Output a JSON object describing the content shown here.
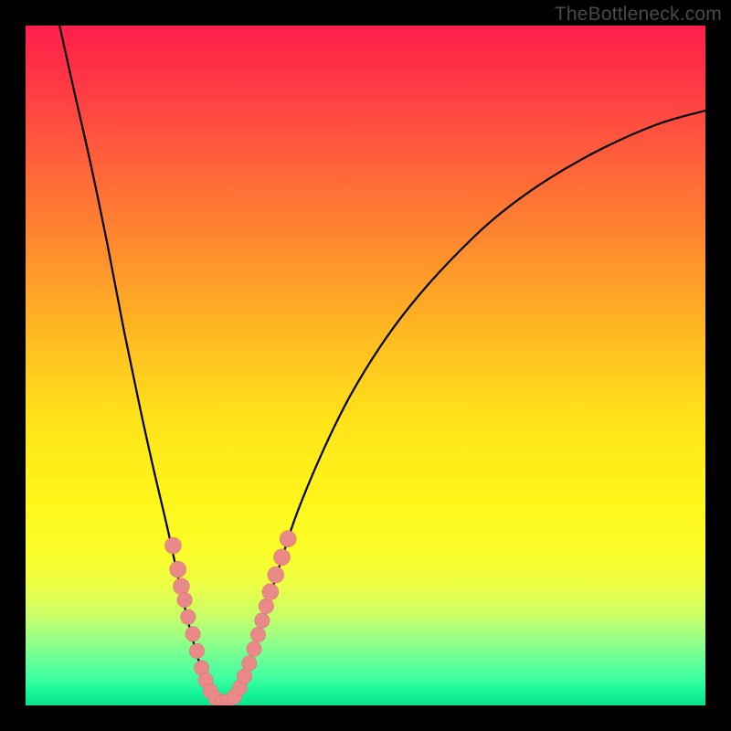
{
  "watermark": "TheBottleneck.com",
  "colors": {
    "background": "#000000",
    "curve_stroke": "#000000",
    "marker_fill": "#e98a88",
    "marker_stroke": "#d77a78"
  },
  "chart_data": {
    "type": "line",
    "title": "",
    "xlabel": "",
    "ylabel": "",
    "xlim": [
      0,
      100
    ],
    "ylim": [
      0,
      100
    ],
    "note": "Values read off the plot as approximate (x,y) percentages of the plot rectangle; y=0 at bottom. Primary curve is the V-shaped black line; markers are the salmon dots along the lower part of the curve.",
    "series": [
      {
        "name": "bottleneck-curve",
        "style": "line",
        "points": [
          {
            "x": 5.0,
            "y": 100.0
          },
          {
            "x": 7.0,
            "y": 91.0
          },
          {
            "x": 9.5,
            "y": 80.0
          },
          {
            "x": 12.0,
            "y": 68.0
          },
          {
            "x": 14.5,
            "y": 55.0
          },
          {
            "x": 17.0,
            "y": 43.0
          },
          {
            "x": 19.0,
            "y": 34.0
          },
          {
            "x": 21.0,
            "y": 25.5
          },
          {
            "x": 22.5,
            "y": 18.5
          },
          {
            "x": 24.0,
            "y": 12.0
          },
          {
            "x": 25.5,
            "y": 6.5
          },
          {
            "x": 27.0,
            "y": 2.5
          },
          {
            "x": 28.5,
            "y": 0.5
          },
          {
            "x": 30.0,
            "y": 0.5
          },
          {
            "x": 31.5,
            "y": 2.5
          },
          {
            "x": 33.0,
            "y": 6.5
          },
          {
            "x": 35.0,
            "y": 13.0
          },
          {
            "x": 37.5,
            "y": 21.0
          },
          {
            "x": 40.0,
            "y": 28.5
          },
          {
            "x": 44.0,
            "y": 38.0
          },
          {
            "x": 48.0,
            "y": 46.0
          },
          {
            "x": 53.0,
            "y": 54.0
          },
          {
            "x": 58.0,
            "y": 60.5
          },
          {
            "x": 64.0,
            "y": 67.0
          },
          {
            "x": 70.0,
            "y": 72.5
          },
          {
            "x": 77.0,
            "y": 77.5
          },
          {
            "x": 85.0,
            "y": 82.0
          },
          {
            "x": 93.0,
            "y": 85.5
          },
          {
            "x": 100.0,
            "y": 87.5
          }
        ]
      },
      {
        "name": "highlight-markers",
        "style": "scatter",
        "points": [
          {
            "x": 21.7,
            "y": 23.5,
            "r": 1.2
          },
          {
            "x": 22.4,
            "y": 20.0,
            "r": 1.2
          },
          {
            "x": 22.9,
            "y": 17.5,
            "r": 1.2
          },
          {
            "x": 23.4,
            "y": 15.5,
            "r": 1.1
          },
          {
            "x": 23.9,
            "y": 13.0,
            "r": 1.1
          },
          {
            "x": 24.6,
            "y": 10.5,
            "r": 1.1
          },
          {
            "x": 25.2,
            "y": 8.0,
            "r": 1.1
          },
          {
            "x": 25.9,
            "y": 5.5,
            "r": 1.1
          },
          {
            "x": 26.5,
            "y": 3.7,
            "r": 1.1
          },
          {
            "x": 27.2,
            "y": 2.1,
            "r": 1.1
          },
          {
            "x": 28.0,
            "y": 1.0,
            "r": 1.1
          },
          {
            "x": 29.0,
            "y": 0.5,
            "r": 1.1
          },
          {
            "x": 29.8,
            "y": 0.6,
            "r": 1.1
          },
          {
            "x": 30.7,
            "y": 1.3,
            "r": 1.1
          },
          {
            "x": 31.5,
            "y": 2.6,
            "r": 1.1
          },
          {
            "x": 32.2,
            "y": 4.3,
            "r": 1.1
          },
          {
            "x": 32.9,
            "y": 6.2,
            "r": 1.1
          },
          {
            "x": 33.6,
            "y": 8.3,
            "r": 1.1
          },
          {
            "x": 34.2,
            "y": 10.4,
            "r": 1.1
          },
          {
            "x": 34.8,
            "y": 12.5,
            "r": 1.1
          },
          {
            "x": 35.4,
            "y": 14.6,
            "r": 1.1
          },
          {
            "x": 36.0,
            "y": 16.7,
            "r": 1.2
          },
          {
            "x": 36.8,
            "y": 19.2,
            "r": 1.2
          },
          {
            "x": 37.7,
            "y": 21.8,
            "r": 1.2
          },
          {
            "x": 38.6,
            "y": 24.5,
            "r": 1.2
          }
        ]
      }
    ]
  }
}
